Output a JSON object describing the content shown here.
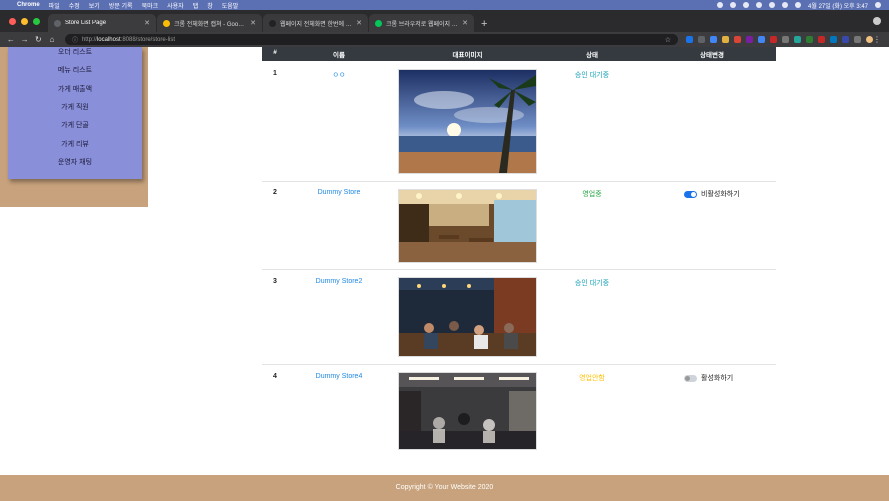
{
  "menubar": {
    "app": "Chrome",
    "items": [
      "파일",
      "수정",
      "보기",
      "방문 기록",
      "북마크",
      "사용자",
      "탭",
      "창",
      "도움말"
    ],
    "clock": "4월 27일 (화) 오후 3:47"
  },
  "tabs": [
    {
      "label": "Store List Page",
      "active": true,
      "favicon_color": "#5f6368"
    },
    {
      "label": "크롬 전체화면 캡쳐 - Google 검색",
      "active": false,
      "favicon_color": "#fbbc05"
    },
    {
      "label": "웹페이지 전체화면 한번에 캡쳐하기(C…",
      "active": false,
      "favicon_color": "#222222"
    },
    {
      "label": "크롬 브라우저로 웹페이지 전체를 한…",
      "active": false,
      "favicon_color": "#03c75a"
    }
  ],
  "toolbar": {
    "url_host": "localhost",
    "url_path": ":8088/store/store-list",
    "url_scheme": "http://"
  },
  "sidebar": {
    "items": [
      "오더 리스트",
      "메뉴 리스트",
      "가게 매출액",
      "가게 직원",
      "가게 단골",
      "가게 리뷰",
      "운영자 채팅"
    ]
  },
  "table": {
    "headers": [
      "#",
      "이름",
      "대표이미지",
      "상태",
      "상태변경"
    ],
    "rows": [
      {
        "num": "1",
        "name": "ㅇㅇ",
        "status": "승인 대기중",
        "status_color": "#17a2b8",
        "action": "",
        "image_theme": "beach"
      },
      {
        "num": "2",
        "name": "Dummy Store",
        "status": "영업중",
        "status_color": "#28a745",
        "action": "비활성화하기",
        "toggle_on": true,
        "image_theme": "cafe1"
      },
      {
        "num": "3",
        "name": "Dummy Store2",
        "status": "승인 대기중",
        "status_color": "#17a2b8",
        "action": "",
        "image_theme": "cafe2"
      },
      {
        "num": "4",
        "name": "Dummy Store4",
        "status": "영업안함",
        "status_color": "#ffc107",
        "action": "활성화하기",
        "toggle_on": false,
        "image_theme": "cafe3"
      }
    ]
  },
  "footer": {
    "text": "Copyright © Your Website 2020"
  }
}
